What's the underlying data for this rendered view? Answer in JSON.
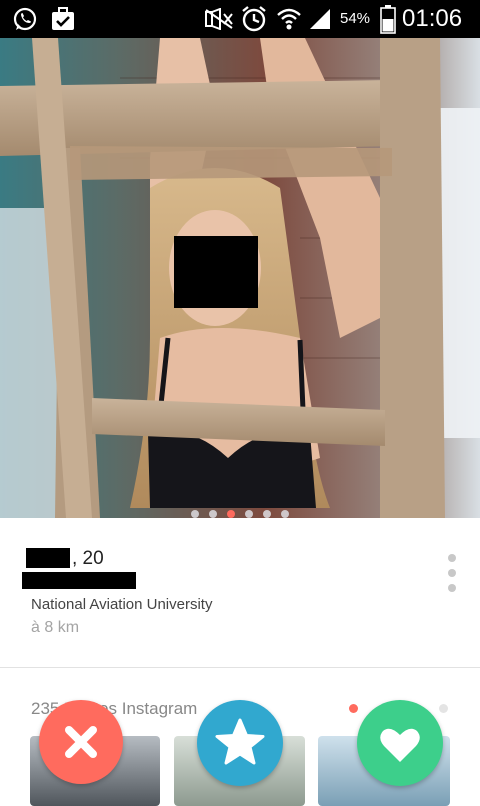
{
  "status_bar": {
    "battery_percent": "54%",
    "time": "01:06",
    "icons": [
      "whatsapp-icon",
      "briefcase-icon",
      "mute-icon",
      "alarm-icon",
      "wifi-icon",
      "signal-icon",
      "battery-icon"
    ]
  },
  "photo": {
    "total": 6,
    "active_index": 2
  },
  "profile": {
    "age_suffix": ", 20",
    "school": "National Aviation University",
    "distance": "à 8 km"
  },
  "instagram": {
    "title": "235 Photos Instagram",
    "pages": 2,
    "active_page": 0
  },
  "actions": {
    "nope": "close-icon",
    "super_like": "star-icon",
    "like": "heart-icon"
  },
  "colors": {
    "nope": "#ff6b5e",
    "super_like": "#31a8cf",
    "like": "#3dcf8b",
    "active_dot": "#ff6b5e"
  }
}
